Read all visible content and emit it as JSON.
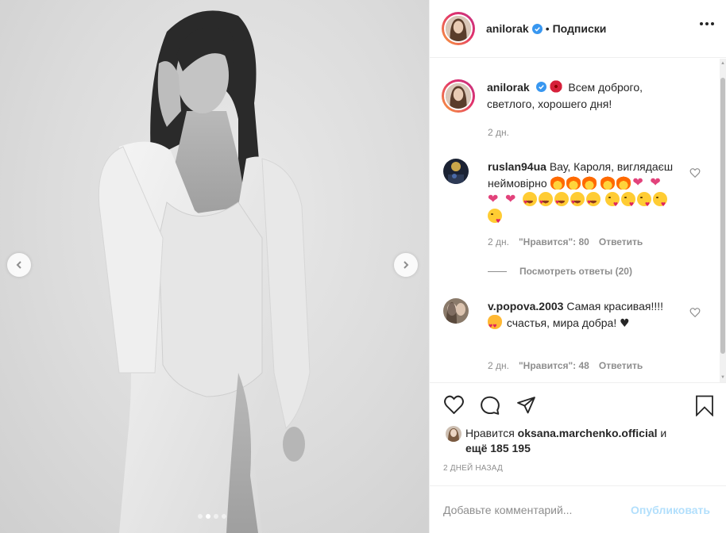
{
  "post": {
    "username": "anilorak",
    "follow_separator": "•",
    "follow_label": "Подписки",
    "more_icon": "more-horizontal-icon",
    "carousel": {
      "total": 4,
      "active_index": 1
    }
  },
  "caption": {
    "username": "anilorak",
    "text": "Всем доброго, светлого, хорошего дня!",
    "time": "2 дн."
  },
  "comments": [
    {
      "username": "ruslan94ua",
      "text": "Вау, Кароля, виглядаєш неймовірно",
      "time": "2 дн.",
      "likes": "\"Нравится\": 80",
      "reply": "Ответить",
      "view_replies": "Посмотреть ответы (20)"
    },
    {
      "username": "v.popova.2003",
      "text": "Самая красивая!!!!",
      "text_after": "счастья, мира добра!",
      "time": "2 дн.",
      "likes": "\"Нравится\": 48",
      "reply": "Ответить"
    }
  ],
  "likes": {
    "prefix": "Нравится",
    "liker": "oksana.marchenko.official",
    "conj": "и",
    "rest": "ещё 185 195"
  },
  "timestamp": "2 ДНЕЙ НАЗАД",
  "add_comment": {
    "placeholder": "Добавьте комментарий...",
    "publish": "Опубликовать"
  },
  "colors": {
    "accent": "#0095f6",
    "publish_disabled": "#b2dffc",
    "verified": "#3897f0",
    "muted": "#8e8e8e"
  }
}
